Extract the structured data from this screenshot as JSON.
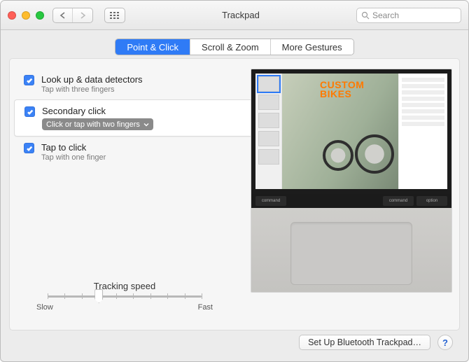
{
  "window": {
    "title": "Trackpad"
  },
  "search": {
    "placeholder": "Search"
  },
  "tabs": [
    {
      "label": "Point & Click",
      "active": true
    },
    {
      "label": "Scroll & Zoom",
      "active": false
    },
    {
      "label": "More Gestures",
      "active": false
    }
  ],
  "options": {
    "lookup": {
      "title": "Look up & data detectors",
      "sub": "Tap with three fingers"
    },
    "secondary": {
      "title": "Secondary click",
      "dropdown": "Click or tap with two fingers"
    },
    "tap": {
      "title": "Tap to click",
      "sub": "Tap with one finger"
    }
  },
  "tracking": {
    "label": "Tracking speed",
    "min_label": "Slow",
    "max_label": "Fast",
    "value": 4,
    "steps": 10
  },
  "preview": {
    "headline1": "CUSTOM",
    "headline2": "BIKES",
    "key_left": "command",
    "key_right1": "command",
    "key_right2": "option"
  },
  "footer": {
    "setup": "Set Up Bluetooth Trackpad…",
    "help": "?"
  }
}
